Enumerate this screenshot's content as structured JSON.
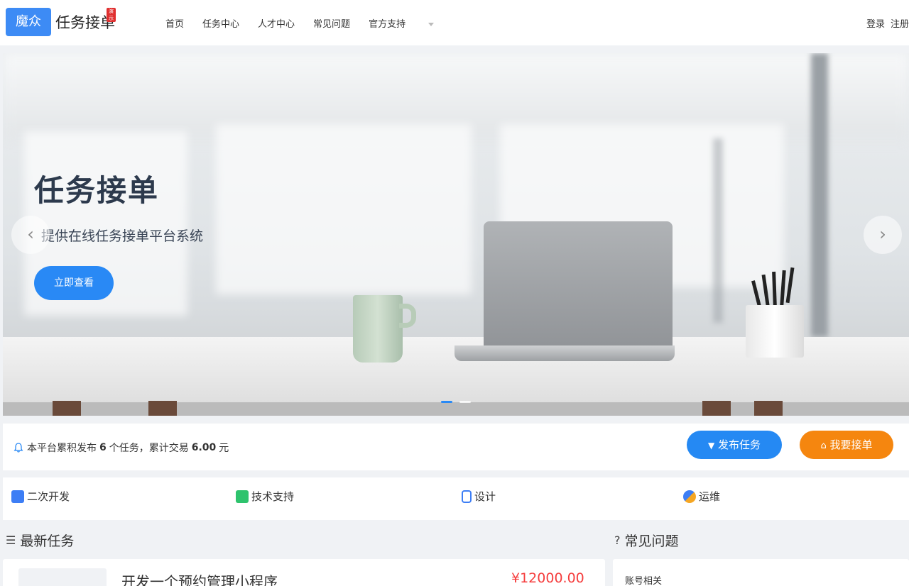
{
  "header": {
    "logo_box": "魔众",
    "logo_text": "任务接单",
    "demo_badge": "演示",
    "nav": [
      "首页",
      "任务中心",
      "人才中心",
      "常见问题",
      "官方支持"
    ],
    "login": "登录",
    "register": "注册"
  },
  "banner": {
    "title": "任务接单",
    "subtitle": "提供在线任务接单平台系统",
    "button": "立即查看",
    "prev_arrow": "‹",
    "next_arrow": "›",
    "slide_count": 2,
    "active_slide": 1
  },
  "stats": {
    "prefix": "本平台累积发布",
    "task_count": "6",
    "middle": "个任务，累计交易",
    "amount": "6.00",
    "suffix": "元",
    "publish_button": "发布任务",
    "take_button": "我要接单"
  },
  "categories": [
    {
      "label": "二次开发",
      "icon": "dev-icon",
      "color": "#3d7ef5"
    },
    {
      "label": "技术支持",
      "icon": "support-icon",
      "color": "#2ec36d"
    },
    {
      "label": "设计",
      "icon": "design-icon",
      "color": "#3d7ef5"
    },
    {
      "label": "运维",
      "icon": "ops-icon",
      "color": "#3d7ef5"
    }
  ],
  "sections": {
    "latest_tasks": "最新任务",
    "faq": "常见问题"
  },
  "tasks": [
    {
      "title": "开发一个预约管理小程序",
      "price": "¥12000.00"
    }
  ],
  "faq": {
    "category": "账号相关"
  },
  "colors": {
    "primary": "#2989f5",
    "orange": "#f5860f",
    "price": "#f53c3c"
  }
}
